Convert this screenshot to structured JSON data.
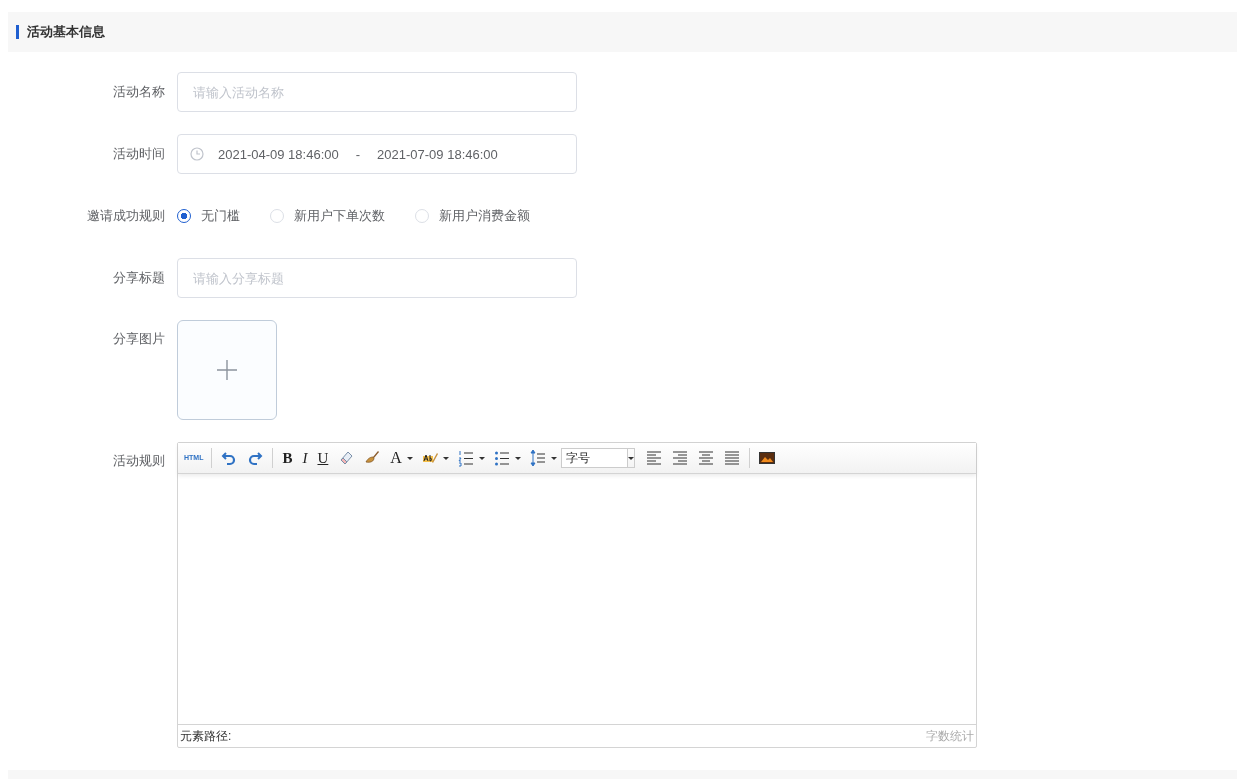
{
  "section": {
    "title": "活动基本信息"
  },
  "form": [
    {
      "kind": "text",
      "label": "活动名称",
      "placeholder": "请输入活动名称"
    },
    {
      "kind": "daterange",
      "label": "活动时间",
      "start": "2021-04-09 18:46:00",
      "separator": "-",
      "end": "2021-07-09 18:46:00"
    },
    {
      "kind": "radio",
      "label": "邀请成功规则",
      "options": [
        {
          "label": "无门槛",
          "selected": true
        },
        {
          "label": "新用户下单次数",
          "selected": false
        },
        {
          "label": "新用户消费金额",
          "selected": false
        }
      ]
    },
    {
      "kind": "text",
      "label": "分享标题",
      "placeholder": "请输入分享标题"
    },
    {
      "kind": "upload",
      "label": "分享图片"
    },
    {
      "kind": "editor",
      "label": "活动规则",
      "toolbar": [
        {
          "kind": "html",
          "text": "HTML"
        },
        {
          "kind": "sep"
        },
        {
          "kind": "undo"
        },
        {
          "kind": "redo"
        },
        {
          "kind": "sep"
        },
        {
          "kind": "bold",
          "text": "B"
        },
        {
          "kind": "italic",
          "text": "I"
        },
        {
          "kind": "underline",
          "text": "U"
        },
        {
          "kind": "eraser"
        },
        {
          "kind": "brush"
        },
        {
          "kind": "fontcolor",
          "text": "A"
        },
        {
          "kind": "highlight"
        },
        {
          "kind": "ol"
        },
        {
          "kind": "ul"
        },
        {
          "kind": "lineheight"
        },
        {
          "kind": "select",
          "text": "字号"
        },
        {
          "kind": "alignleft"
        },
        {
          "kind": "alignright"
        },
        {
          "kind": "aligncenter"
        },
        {
          "kind": "justify"
        },
        {
          "kind": "sep"
        },
        {
          "kind": "image"
        }
      ],
      "path_label": "元素路径:",
      "word_count": "字数统计"
    }
  ]
}
